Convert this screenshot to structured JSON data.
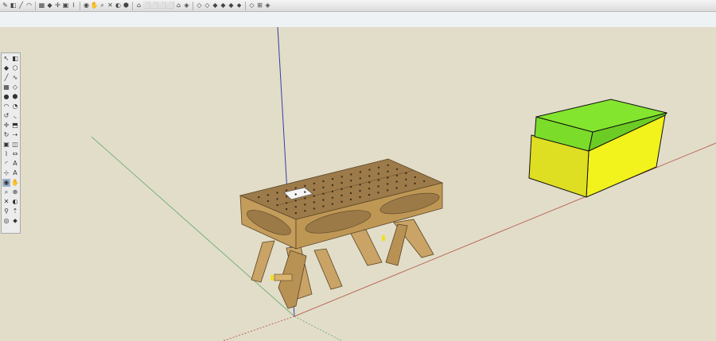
{
  "window": {
    "title": ""
  },
  "colors": {
    "background": "#e2ddc9",
    "sky": "#eef2f4",
    "blue_axis": "#3a3aa8",
    "red_axis": "#b86a5a",
    "green_axis": "#79b27a",
    "box_top": "#7bdc2a",
    "box_front": "#e3e42a",
    "box_side": "#f2f21c",
    "wood": "#b89255",
    "wood_top": "#9c7a4a"
  },
  "top_toolbar": [
    {
      "name": "pencil-icon",
      "glyph": "✎"
    },
    {
      "name": "eraser-icon",
      "glyph": "◧"
    },
    {
      "name": "line-icon",
      "glyph": "╱"
    },
    {
      "name": "arc-icon",
      "glyph": "◠"
    },
    {
      "name": "rectangle-icon",
      "glyph": "▦"
    },
    {
      "name": "paint-bucket-icon",
      "glyph": "◆"
    },
    {
      "name": "move-icon",
      "glyph": "✛"
    },
    {
      "name": "scale-icon",
      "glyph": "▣"
    },
    {
      "name": "tape-measure-icon",
      "glyph": "⌇"
    },
    {
      "name": "orbit-icon",
      "glyph": "◉"
    },
    {
      "name": "pan-icon",
      "glyph": "✋"
    },
    {
      "name": "zoom-icon",
      "glyph": "⌕"
    },
    {
      "name": "zoom-extents-icon",
      "glyph": "✕"
    },
    {
      "name": "previous-view-icon",
      "glyph": "◐"
    },
    {
      "name": "warehouse-icon",
      "glyph": "⬢"
    },
    {
      "name": "iso-view-icon",
      "glyph": "⌂"
    },
    {
      "name": "top-view-icon",
      "glyph": "⬜"
    },
    {
      "name": "front-view-icon",
      "glyph": "⬜"
    },
    {
      "name": "right-view-icon",
      "glyph": "⬜"
    },
    {
      "name": "back-view-icon",
      "glyph": "⬜"
    },
    {
      "name": "left-view-icon",
      "glyph": "⌂"
    },
    {
      "name": "xray-icon",
      "glyph": "◈"
    },
    {
      "name": "wireframe-icon",
      "glyph": "◇"
    },
    {
      "name": "hidden-line-icon",
      "glyph": "◇"
    },
    {
      "name": "shaded-icon",
      "glyph": "◆"
    },
    {
      "name": "shaded-textures-icon",
      "glyph": "◆"
    },
    {
      "name": "monochrome-icon",
      "glyph": "◆"
    },
    {
      "name": "section-plane-icon",
      "glyph": "⬥"
    },
    {
      "name": "display-section-icon",
      "glyph": "◇"
    },
    {
      "name": "section-cuts-icon",
      "glyph": "⊞"
    },
    {
      "name": "styles-icon",
      "glyph": "◈"
    }
  ],
  "palette": [
    [
      {
        "name": "select-icon",
        "glyph": "↖"
      },
      {
        "name": "eraser-tool-icon",
        "glyph": "◧"
      }
    ],
    [
      {
        "name": "paint-tool-icon",
        "glyph": "◆"
      },
      {
        "name": "components-icon",
        "glyph": "⬡"
      }
    ],
    [
      {
        "name": "line-tool-icon",
        "glyph": "╱"
      },
      {
        "name": "freehand-icon",
        "glyph": "∿"
      }
    ],
    [
      {
        "name": "rectangle-tool-icon",
        "glyph": "▦"
      },
      {
        "name": "rotated-rectangle-icon",
        "glyph": "◇"
      }
    ],
    [
      {
        "name": "circle-tool-icon",
        "glyph": "●"
      },
      {
        "name": "polygon-tool-icon",
        "glyph": "⬢"
      }
    ],
    [
      {
        "name": "arc-tool-icon",
        "glyph": "◠"
      },
      {
        "name": "pie-tool-icon",
        "glyph": "◔"
      }
    ],
    [
      {
        "name": "rotate-arc-icon",
        "glyph": "↺"
      },
      {
        "name": "three-point-arc-icon",
        "glyph": "◟"
      }
    ],
    [
      {
        "name": "move-tool-icon",
        "glyph": "✛"
      },
      {
        "name": "push-pull-icon",
        "glyph": "⬒"
      }
    ],
    [
      {
        "name": "rotate-tool-icon",
        "glyph": "↻"
      },
      {
        "name": "follow-me-icon",
        "glyph": "⇢"
      }
    ],
    [
      {
        "name": "scale-tool-icon",
        "glyph": "▣"
      },
      {
        "name": "offset-tool-icon",
        "glyph": "◫"
      }
    ],
    [
      {
        "name": "tape-tool-icon",
        "glyph": "⌇"
      },
      {
        "name": "dimension-icon",
        "glyph": "⇔"
      }
    ],
    [
      {
        "name": "protractor-icon",
        "glyph": "◜"
      },
      {
        "name": "text-tool-icon",
        "glyph": "A"
      }
    ],
    [
      {
        "name": "axes-tool-icon",
        "glyph": "⊹"
      },
      {
        "name": "3d-text-icon",
        "glyph": "A"
      }
    ],
    [
      {
        "name": "orbit-tool-icon",
        "glyph": "◉"
      },
      {
        "name": "pan-tool-icon",
        "glyph": "✋"
      }
    ],
    [
      {
        "name": "zoom-tool-icon",
        "glyph": "⌕"
      },
      {
        "name": "zoom-window-icon",
        "glyph": "⊕"
      }
    ],
    [
      {
        "name": "zoom-extents-tool-icon",
        "glyph": "✕"
      },
      {
        "name": "previous-icon",
        "glyph": "◐"
      }
    ],
    [
      {
        "name": "position-camera-icon",
        "glyph": "⚲"
      },
      {
        "name": "walk-icon",
        "glyph": "⇡"
      }
    ],
    [
      {
        "name": "look-around-icon",
        "glyph": "◎"
      },
      {
        "name": "section-tool-icon",
        "glyph": "⬥"
      }
    ]
  ]
}
